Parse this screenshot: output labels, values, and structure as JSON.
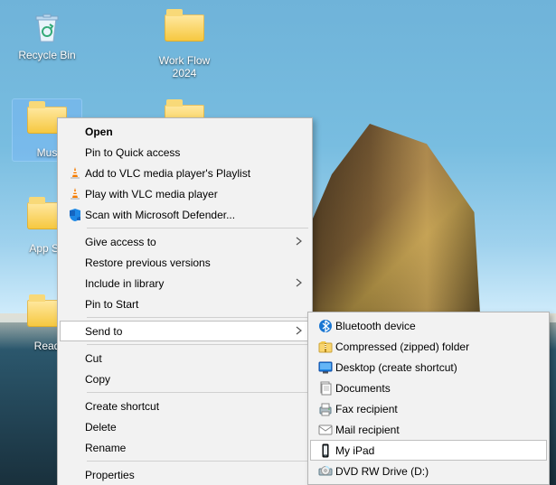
{
  "desktop_icons": {
    "recycle_bin": "Recycle Bin",
    "work_flow": "Work Flow 2024",
    "music": "Mus",
    "app_se": "App Se",
    "read": "Read"
  },
  "context_menu": {
    "open": "Open",
    "pin_quick": "Pin to Quick access",
    "vlc_add": "Add to VLC media player's Playlist",
    "vlc_play": "Play with VLC media player",
    "defender": "Scan with Microsoft Defender...",
    "give_access": "Give access to",
    "restore": "Restore previous versions",
    "include_lib": "Include in library",
    "pin_start": "Pin to Start",
    "send_to": "Send to",
    "cut": "Cut",
    "copy": "Copy",
    "create_shortcut": "Create shortcut",
    "delete": "Delete",
    "rename": "Rename",
    "properties": "Properties"
  },
  "send_to_menu": {
    "bluetooth": "Bluetooth device",
    "zip": "Compressed (zipped) folder",
    "desktop": "Desktop (create shortcut)",
    "documents": "Documents",
    "fax": "Fax recipient",
    "mail": "Mail recipient",
    "ipad": "My iPad",
    "dvd": "DVD RW Drive (D:)"
  }
}
